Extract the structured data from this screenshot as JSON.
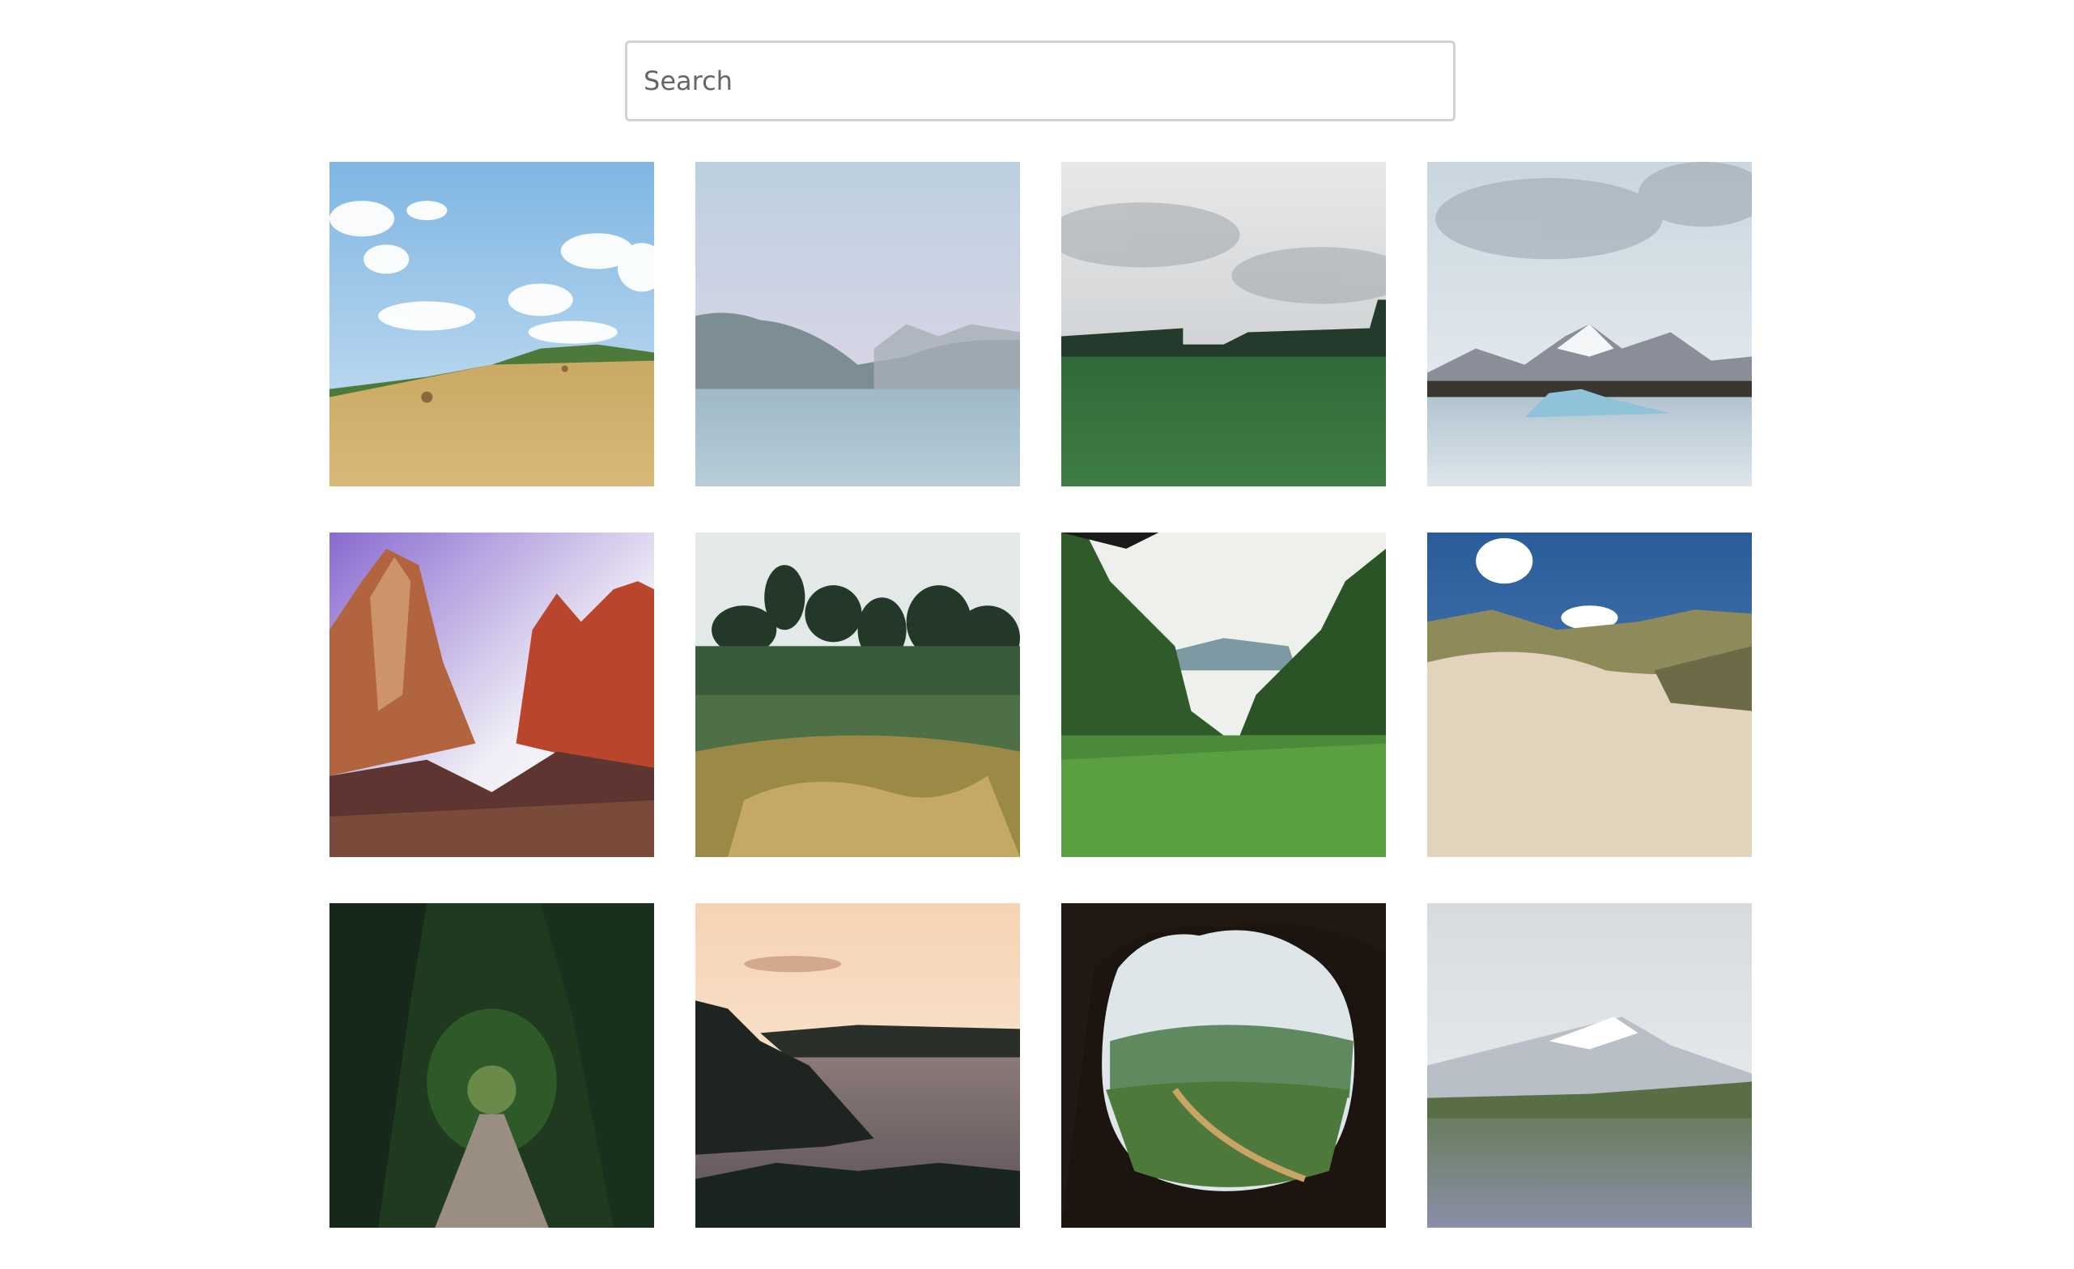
{
  "search": {
    "placeholder": "Search",
    "value": ""
  },
  "gallery": {
    "images": [
      {
        "name": "wheat-field-hay-bales"
      },
      {
        "name": "lake-mountains-pastel"
      },
      {
        "name": "green-field-overcast"
      },
      {
        "name": "glacier-lagoon-icebergs"
      },
      {
        "name": "red-rock-canyon-peaks"
      },
      {
        "name": "garden-trees-shrubs"
      },
      {
        "name": "jungle-valley-view"
      },
      {
        "name": "sand-dunes-grass"
      },
      {
        "name": "tree-tunnel-path"
      },
      {
        "name": "coastal-cliffs-sunset"
      },
      {
        "name": "cave-opening-valley"
      },
      {
        "name": "snowy-mountain-meadow"
      }
    ]
  }
}
